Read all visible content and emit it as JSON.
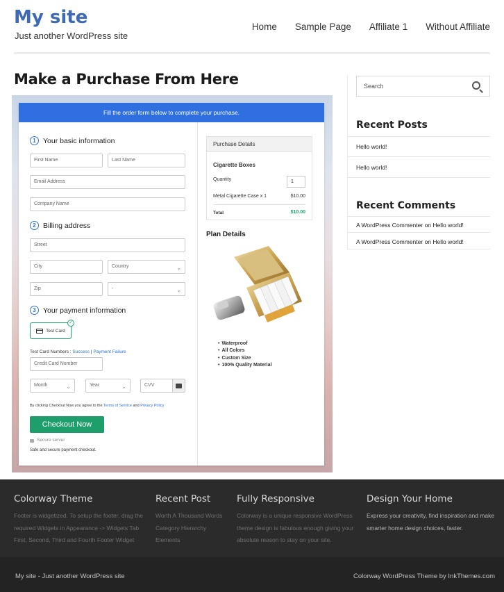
{
  "header": {
    "site_title": "My site",
    "site_description": "Just another WordPress site",
    "nav": [
      "Home",
      "Sample Page",
      "Affiliate 1",
      "Without Affiliate"
    ]
  },
  "main": {
    "page_title": "Make a Purchase From Here",
    "form": {
      "banner": "Fill the order form below to complete your purchase.",
      "section1": {
        "number": "1",
        "title": "Your basic information"
      },
      "section2": {
        "number": "2",
        "title": "Billing address"
      },
      "section3": {
        "number": "3",
        "title": "Your payment information"
      },
      "fields": {
        "first_name": "First Name",
        "last_name": "Last Name",
        "email": "Email Address",
        "company": "Company Name",
        "street": "Street",
        "city": "City",
        "country": "Country",
        "zip": "Zip",
        "state": "-",
        "card_number": "Credit Card Number",
        "month": "Month",
        "year": "Year",
        "cvv": "CVV"
      },
      "test_card_label": "Test Card",
      "test_numbers_prefix": "Test Card Numbers : ",
      "test_success": "Success",
      "test_sep": " | ",
      "test_failure": "Payment Failure",
      "terms_prefix": "By clicking Checkout Now you agree to the ",
      "terms_link": "Terms of Service",
      "terms_and": " and ",
      "privacy_link": "Privacy Policy",
      "checkout_button": "Checkout Now",
      "secure_server": "Secure server",
      "secure_note": "Safe and secure payment checkout."
    },
    "purchase_details": {
      "heading": "Purchase Details",
      "product": "Cigarette Boxes",
      "quantity_label": "Quantity",
      "quantity_value": "1",
      "line_item": "Metal Cigarette Case x 1",
      "line_price": "$10.00",
      "total_label": "Total",
      "total_value": "$10.00"
    },
    "plan_details": {
      "heading": "Plan Details",
      "features": [
        "Waterproof",
        "All Colors",
        "Custom Size",
        "100% Quality Material"
      ]
    }
  },
  "sidebar": {
    "search_placeholder": "Search",
    "recent_posts_title": "Recent Posts",
    "recent_posts": [
      "Hello world!",
      "Hello world!"
    ],
    "recent_comments_title": "Recent Comments",
    "recent_comments": [
      {
        "author": "A WordPress Commenter",
        "on": " on ",
        "post": "Hello world!"
      },
      {
        "author": "A WordPress Commenter",
        "on": " on ",
        "post": "Hello world!"
      }
    ]
  },
  "footer": {
    "columns": [
      {
        "title": "Colorway Theme",
        "lines": [
          "Footer is widgetized. To setup the footer, drag the",
          "required Widgets in Appearance -> Widgets Tab",
          "First, Second, Third and Fourth Footer Widget"
        ]
      },
      {
        "title": "Recent Post",
        "lines": [
          "Worth A Thousand Words",
          "Category Hierarchy",
          "Elements"
        ]
      },
      {
        "title": "Fully Responsive",
        "lines": [
          "Colorway is a unique responsive WordPress",
          "theme design is fabulous enough giving your",
          "absolute reason to stay on your site."
        ]
      },
      {
        "title": "Design Your Home",
        "lines": [
          "Express your creativity, find inspiration and make",
          "smarter home design choices, faster."
        ]
      }
    ],
    "bottom_left": "My site - Just another WordPress site",
    "bottom_right": "Colorway WordPress Theme by InkThemes.com"
  },
  "colors": {
    "brand_blue": "#3e6ab5",
    "banner_blue": "#2f6fe0",
    "checkout_green": "#1e9e6a",
    "footer_bg": "#2b2b2b"
  }
}
